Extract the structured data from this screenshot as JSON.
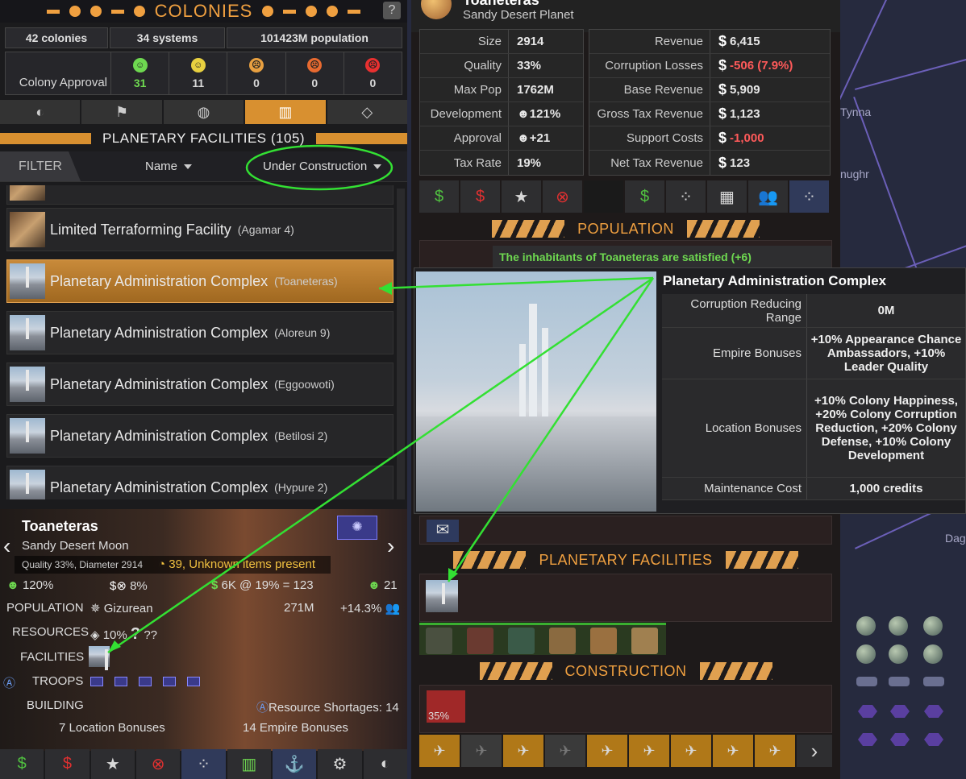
{
  "colonies_header": {
    "title": "COLONIES",
    "help": "?"
  },
  "summary": {
    "colonies": "42 colonies",
    "systems": "34 systems",
    "population": "101423M population"
  },
  "approval": {
    "label": "Colony Approval",
    "counts": [
      "31",
      "11",
      "0",
      "0",
      "0"
    ],
    "colors": [
      "#6ed850",
      "#e8d040",
      "#e8a040",
      "#e86a30",
      "#e83030"
    ]
  },
  "tabs": [
    {
      "name": "tab-planets",
      "icon": "planet-icon"
    },
    {
      "name": "tab-colonize",
      "icon": "flag-icon"
    },
    {
      "name": "tab-systems",
      "icon": "globe-icon"
    },
    {
      "name": "tab-facilities",
      "icon": "building-icon",
      "active": true
    },
    {
      "name": "tab-resources",
      "icon": "diamond-icon"
    }
  ],
  "facilities_section": {
    "title": "PLANETARY FACILITIES (105)"
  },
  "filter": {
    "label": "FILTER",
    "sort": "Name",
    "status": "Under Construction"
  },
  "facility_list": [
    {
      "name": "Limited Terraforming Facility",
      "location": "(Agamar 4)"
    },
    {
      "name": "Planetary Administration Complex",
      "location": "(Toaneteras)",
      "selected": true
    },
    {
      "name": "Planetary Administration Complex",
      "location": "(Aloreun 9)"
    },
    {
      "name": "Planetary Administration Complex",
      "location": "(Eggoowoti)"
    },
    {
      "name": "Planetary Administration Complex",
      "location": "(Betilosi 2)"
    },
    {
      "name": "Planetary Administration Complex",
      "location": "(Hypure 2)"
    }
  ],
  "planet": {
    "name": "Toaneteras",
    "type": "Sandy Desert Moon",
    "quality_line": "Quality 33%, Diameter 2914",
    "items": "39, Unknown items present",
    "development": "120%",
    "corruption": "8%",
    "tax": "6K @ 19% = 123",
    "happiness": "21",
    "population_label": "POPULATION",
    "race": "Gizurean",
    "pop_amount": "271M",
    "pop_growth": "+14.3%",
    "resources_label": "RESOURCES",
    "resource_pct": "10%",
    "resource_unknown": "??",
    "facilities_label": "FACILITIES",
    "troops_label": "TROOPS",
    "building_label": "BUILDING",
    "shortages": "Resource Shortages: 14",
    "location_bonuses": "7 Location Bonuses",
    "empire_bonuses": "14 Empire Bonuses"
  },
  "detail": {
    "name": "Toaneteras",
    "type": "Sandy Desert Planet",
    "left_stats": [
      {
        "k": "Size",
        "v": "2914"
      },
      {
        "k": "Quality",
        "v": "33%"
      },
      {
        "k": "Max Pop",
        "v": "1762M"
      },
      {
        "k": "Development",
        "v": "121%"
      },
      {
        "k": "Approval",
        "v": "+21"
      },
      {
        "k": "Tax Rate",
        "v": "19%"
      }
    ],
    "right_stats": [
      {
        "k": "Revenue",
        "v": "6,415"
      },
      {
        "k": "Corruption Losses",
        "v": "-506 (7.9%)"
      },
      {
        "k": "Base Revenue",
        "v": "5,909"
      },
      {
        "k": "Gross Tax Revenue",
        "v": "1,123"
      },
      {
        "k": "Support Costs",
        "v": "-1,000"
      },
      {
        "k": "Net Tax Revenue",
        "v": "123"
      }
    ],
    "population_title": "POPULATION",
    "satisfaction": "The inhabitants of Toaneteras are satisfied (+6)",
    "facilities_title": "PLANETARY FACILITIES",
    "construction_title": "CONSTRUCTION",
    "construction_progress": "35%"
  },
  "tooltip": {
    "title": "Planetary Administration Complex",
    "rows": [
      {
        "k": "Corruption Reducing Range",
        "v": "0M"
      },
      {
        "k": "Empire Bonuses",
        "v": "+10% Appearance Chance Ambassadors, +10% Leader Quality"
      },
      {
        "k": "Location Bonuses",
        "v": "+10% Colony Happiness, +20% Colony Corruption Reduction, +20% Colony Defense, +10% Colony Development"
      },
      {
        "k": "Maintenance Cost",
        "v": "1,000 credits"
      }
    ]
  },
  "map_labels": [
    "Tynna",
    "nughr",
    "Dag"
  ]
}
